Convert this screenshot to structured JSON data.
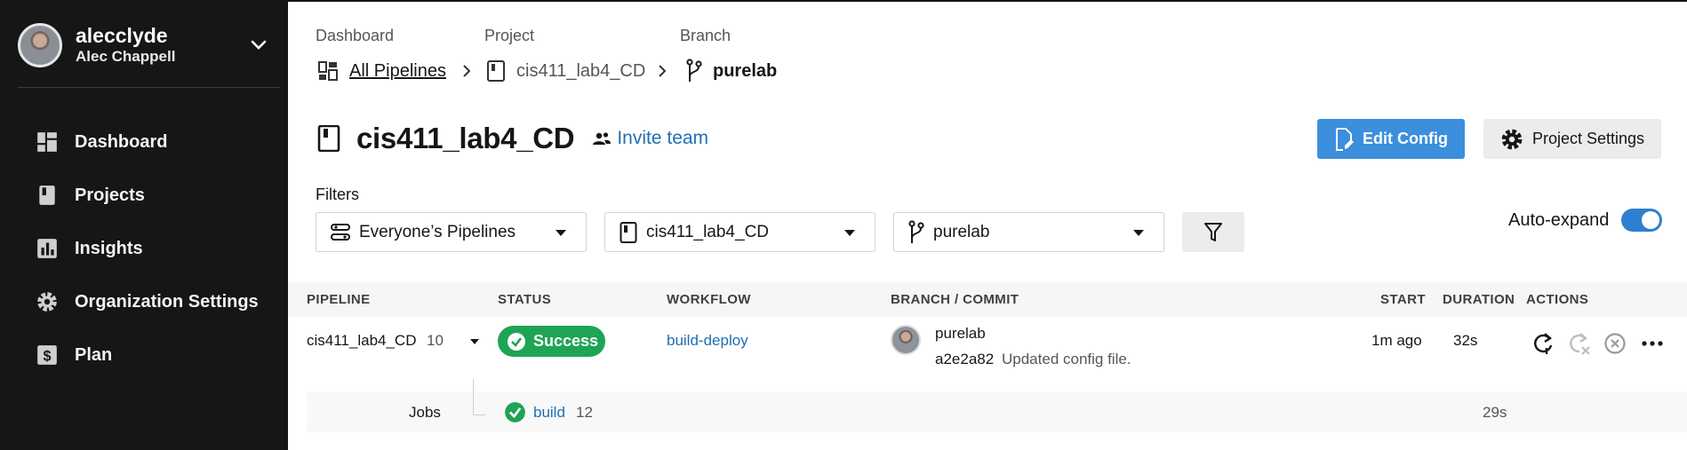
{
  "user": {
    "username": "alecclyde",
    "full_name": "Alec Chappell"
  },
  "sidebar": {
    "items": [
      {
        "label": "Dashboard",
        "icon": "dashboard-icon"
      },
      {
        "label": "Projects",
        "icon": "projects-icon"
      },
      {
        "label": "Insights",
        "icon": "insights-icon"
      },
      {
        "label": "Organization Settings",
        "icon": "gear-icon"
      },
      {
        "label": "Plan",
        "icon": "plan-icon"
      }
    ]
  },
  "breadcrumb": {
    "dashboard_label": "Dashboard",
    "dashboard_value": "All Pipelines",
    "project_label": "Project",
    "project_value": "cis411_lab4_CD",
    "branch_label": "Branch",
    "branch_value": "purelab"
  },
  "project": {
    "title": "cis411_lab4_CD",
    "invite_label": "Invite team",
    "edit_config_label": "Edit Config",
    "project_settings_label": "Project Settings"
  },
  "filters": {
    "label": "Filters",
    "pipelines_select": "Everyone’s Pipelines",
    "project_select": "cis411_lab4_CD",
    "branch_select": "purelab",
    "auto_expand_label": "Auto-expand",
    "auto_expand_on": true
  },
  "table": {
    "headers": {
      "pipeline": "PIPELINE",
      "status": "STATUS",
      "workflow": "WORKFLOW",
      "branch_commit": "BRANCH / COMMIT",
      "start": "START",
      "duration": "DURATION",
      "actions": "ACTIONS"
    },
    "row": {
      "pipeline_name": "cis411_lab4_CD",
      "pipeline_number": "10",
      "status": "Success",
      "workflow": "build-deploy",
      "branch": "purelab",
      "commit_hash": "a2e2a82",
      "commit_message": "Updated config file.",
      "start": "1m ago",
      "duration": "32s"
    },
    "jobs": {
      "label": "Jobs",
      "job_name": "build",
      "job_number": "12",
      "duration": "29s"
    }
  },
  "colors": {
    "sidebar_bg": "#161616",
    "accent_blue": "#3b8fdd",
    "link_blue": "#1e6fb2",
    "success_green": "#1ea454"
  }
}
